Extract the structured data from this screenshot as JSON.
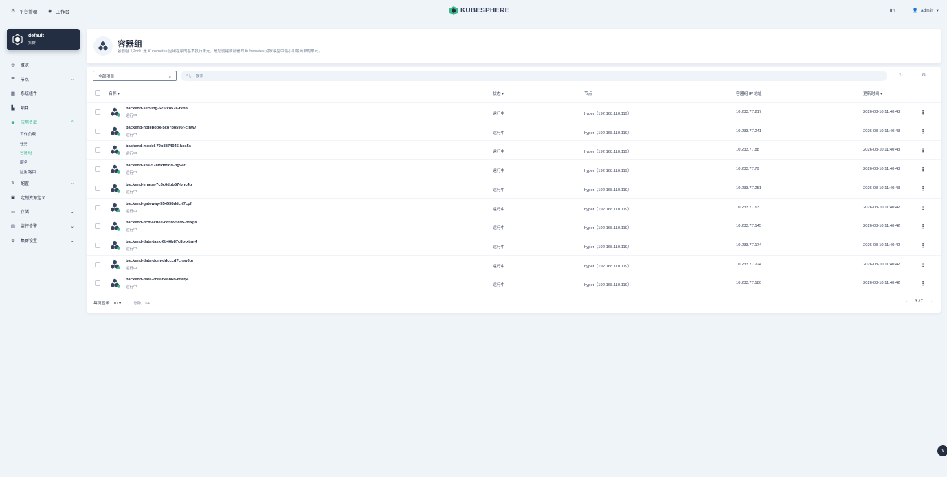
{
  "topbar": {
    "platform_label": "平台管理",
    "workbench_label": "工作台",
    "logo_text": "KUBESPHERE",
    "user_label": "admin"
  },
  "cluster": {
    "name": "default",
    "type": "集群"
  },
  "nav": {
    "items": [
      {
        "label": "概览",
        "icon": "dashboard-icon",
        "chevron": false
      },
      {
        "label": "节点",
        "icon": "nodes-icon",
        "chevron": true
      },
      {
        "label": "系统组件",
        "icon": "components-icon",
        "chevron": false
      },
      {
        "label": "项目",
        "icon": "projects-icon",
        "chevron": false
      },
      {
        "label": "应用负载",
        "icon": "workloads-icon",
        "chevron": true,
        "active": true
      }
    ],
    "sub_items": [
      {
        "label": "工作负载"
      },
      {
        "label": "任务"
      },
      {
        "label": "容器组",
        "active": true
      },
      {
        "label": "服务"
      },
      {
        "label": "应用路由"
      }
    ],
    "items_after": [
      {
        "label": "配置",
        "icon": "config-icon",
        "chevron": true
      },
      {
        "label": "定制资源定义",
        "icon": "crd-icon",
        "chevron": false
      },
      {
        "label": "存储",
        "icon": "storage-icon",
        "chevron": true
      },
      {
        "label": "监控告警",
        "icon": "monitoring-icon",
        "chevron": true
      },
      {
        "label": "集群设置",
        "icon": "settings-icon",
        "chevron": true
      }
    ]
  },
  "header": {
    "title": "容器组",
    "description": "容器组（Pod）是 Kubernetes 应用程序的基本执行单元，是您创建或部署的 Kubernetes 对象模型中最小和最简单的单元。"
  },
  "toolbar": {
    "project_select": "全部项目",
    "search_placeholder": "搜索"
  },
  "table": {
    "columns": {
      "name": "名称",
      "status": "状态",
      "node": "节点",
      "ip": "容器组 IP 地址",
      "updated": "更新时间"
    },
    "rows": [
      {
        "name": "backend-serving-675fc8576-rkn8",
        "sub": "运行中",
        "status": "运行中",
        "node": "hyper（192.168.110.119）",
        "ip": "10.233.77.217",
        "updated": "2026-03-10 11:40:43"
      },
      {
        "name": "backend-notebook-5c87b8596f-cjnw7",
        "sub": "运行中",
        "status": "运行中",
        "node": "hyper（192.168.110.119）",
        "ip": "10.233.77.241",
        "updated": "2026-03-10 11:40:43"
      },
      {
        "name": "backend-model-79b8874945-kcs5s",
        "sub": "运行中",
        "status": "运行中",
        "node": "hyper（192.168.110.119）",
        "ip": "10.233.77.88",
        "updated": "2026-03-10 11:40:43"
      },
      {
        "name": "backend-k8s-578f5d85dd-bg94r",
        "sub": "运行中",
        "status": "运行中",
        "node": "hyper（192.168.110.119）",
        "ip": "10.233.77.79",
        "updated": "2026-03-10 11:40:43"
      },
      {
        "name": "backend-image-7c6c6dbb57-bhc4p",
        "sub": "运行中",
        "status": "运行中",
        "node": "hyper（192.168.110.119）",
        "ip": "10.233.77.251",
        "updated": "2026-03-10 11:40:43"
      },
      {
        "name": "backend-gateway-554558ddc-t7cpf",
        "sub": "运行中",
        "status": "运行中",
        "node": "hyper（192.168.110.119）",
        "ip": "10.233.77.63",
        "updated": "2026-03-10 11:40:42"
      },
      {
        "name": "backend-dcm4chee-c85b95895-b5xpx",
        "sub": "运行中",
        "status": "运行中",
        "node": "hyper（192.168.110.119）",
        "ip": "10.233.77.145",
        "updated": "2026-03-10 11:40:42"
      },
      {
        "name": "backend-data-task-6b46b87c8b-xtmr4",
        "sub": "运行中",
        "status": "运行中",
        "node": "hyper（192.168.110.119）",
        "ip": "10.233.77.174",
        "updated": "2026-03-10 11:40:42"
      },
      {
        "name": "backend-data-dcm-ddcccd7c-sw6br",
        "sub": "运行中",
        "status": "运行中",
        "node": "hyper（192.168.110.119）",
        "ip": "10.233.77.224",
        "updated": "2026-03-10 11:40:42"
      },
      {
        "name": "backend-data-7b66b46b6b-8twq4",
        "sub": "运行中",
        "status": "运行中",
        "node": "hyper（192.168.110.119）",
        "ip": "10.233.77.180",
        "updated": "2026-03-10 11:40:42"
      }
    ]
  },
  "pagination": {
    "per_page_label": "每页显示：",
    "per_page_value": "10",
    "total_label": "总数：64",
    "page": "3 / 7"
  },
  "colors": {
    "accent": "#3dba8b",
    "dark": "#242e42",
    "background": "#eff4f9"
  }
}
